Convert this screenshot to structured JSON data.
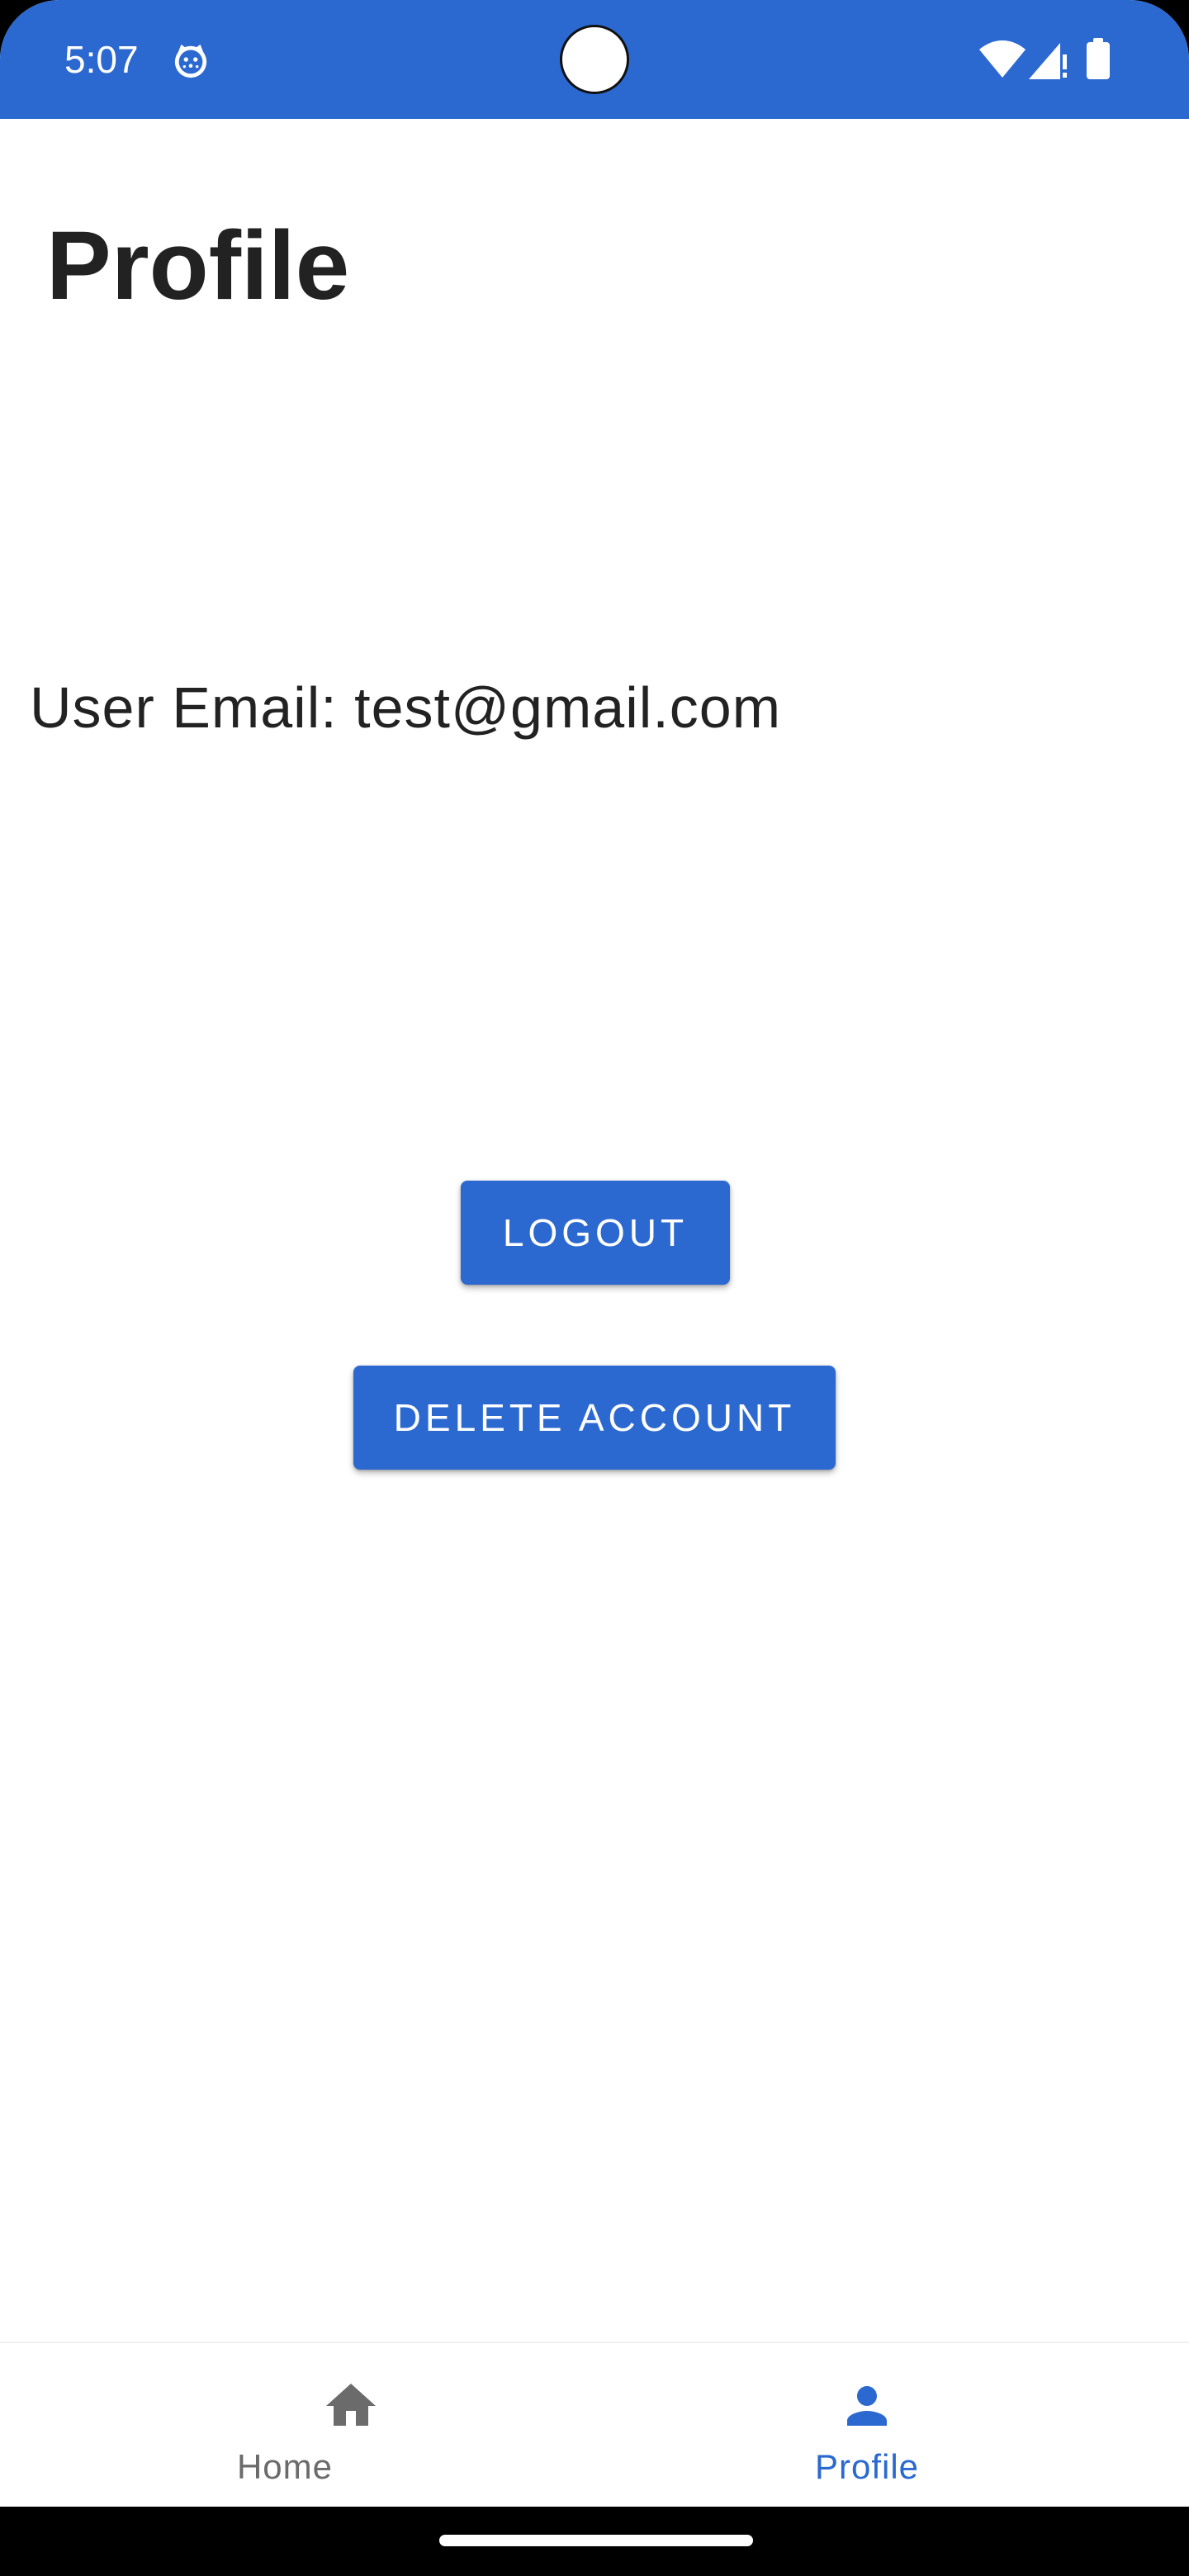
{
  "status_bar": {
    "time": "5:07",
    "app_icon": "cat-face-icon",
    "icons": [
      "wifi-icon",
      "signal-icon",
      "battery-icon"
    ],
    "background_color": "#2b69d1"
  },
  "page": {
    "title": "Profile",
    "user_email_text": "User Email: test@gmail.com"
  },
  "actions": {
    "logout_label": "LOGOUT",
    "delete_account_label": "DELETE ACCOUNT",
    "button_color": "#2b69d1"
  },
  "bottom_nav": {
    "items": [
      {
        "label": "Home",
        "icon": "home-icon",
        "selected": false,
        "color": "#6b6b6b"
      },
      {
        "label": "Profile",
        "icon": "person-icon",
        "selected": true,
        "color": "#2b69d1"
      }
    ]
  }
}
